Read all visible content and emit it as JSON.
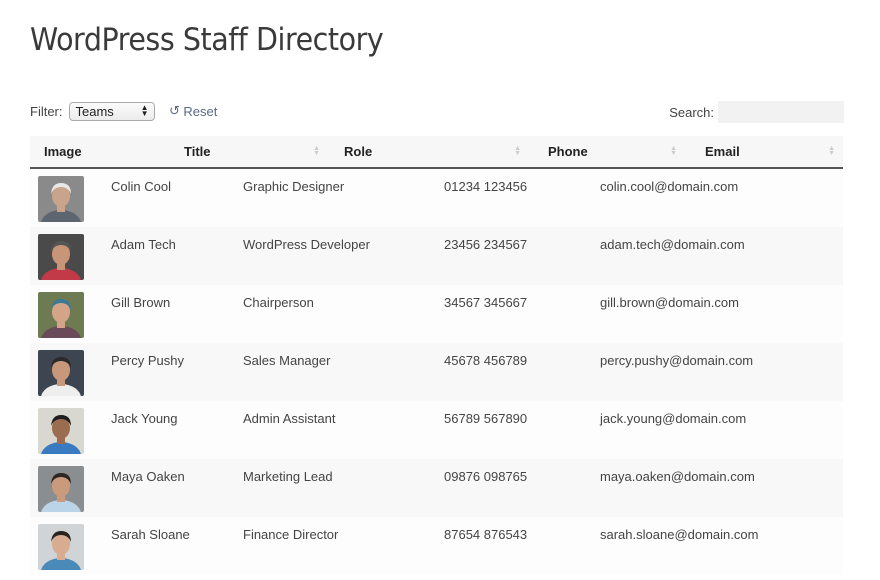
{
  "page": {
    "title": "WordPress Staff Directory"
  },
  "filter": {
    "label": "Filter:",
    "selected": "Teams",
    "reset_label": "Reset",
    "reset_icon": "undo-icon"
  },
  "search": {
    "label": "Search:",
    "value": "",
    "placeholder": ""
  },
  "table": {
    "headers": [
      "Image",
      "Title",
      "Role",
      "Phone",
      "Email"
    ],
    "rows": [
      {
        "name": "Colin Cool",
        "role": "Graphic Designer",
        "phone": "01234 123456",
        "email": "colin.cool@domain.com",
        "avatar": {
          "bg": "#8a8a8a",
          "skin": "#c9a48a",
          "hair": "#e8e8e8",
          "shirt": "#5d6570"
        }
      },
      {
        "name": "Adam Tech",
        "role": "WordPress Developer",
        "phone": "23456 234567",
        "email": "adam.tech@domain.com",
        "avatar": {
          "bg": "#4a4a4a",
          "skin": "#c99578",
          "hair": "#555555",
          "shirt": "#c23a48"
        }
      },
      {
        "name": "Gill Brown",
        "role": "Chairperson",
        "phone": "34567 345667",
        "email": "gill.brown@domain.com",
        "avatar": {
          "bg": "#6d7a52",
          "skin": "#d4a488",
          "hair": "#3a7a95",
          "shirt": "#6a4a58"
        }
      },
      {
        "name": "Percy Pushy",
        "role": "Sales Manager",
        "phone": "45678 456789",
        "email": "percy.pushy@domain.com",
        "avatar": {
          "bg": "#3d4550",
          "skin": "#c8987a",
          "hair": "#2a2a2a",
          "shirt": "#eeeeee"
        }
      },
      {
        "name": "Jack Young",
        "role": "Admin Assistant",
        "phone": "56789 567890",
        "email": "jack.young@domain.com",
        "avatar": {
          "bg": "#d8d8d0",
          "skin": "#9a6c50",
          "hair": "#1e1e1e",
          "shirt": "#3a7ac0"
        }
      },
      {
        "name": "Maya Oaken",
        "role": "Marketing Lead",
        "phone": "09876 098765",
        "email": "maya.oaken@domain.com",
        "avatar": {
          "bg": "#8a8e90",
          "skin": "#c99a7c",
          "hair": "#2e2622",
          "shirt": "#bcd4e8"
        }
      },
      {
        "name": "Sarah Sloane",
        "role": "Finance Director",
        "phone": "87654 876543",
        "email": "sarah.sloane@domain.com",
        "avatar": {
          "bg": "#d0d4d6",
          "skin": "#d8ac90",
          "hair": "#2a2420",
          "shirt": "#4a8ab8"
        }
      }
    ]
  },
  "colors": {
    "reset_link": "#5c6a86",
    "header_bg": "#f7f7f7",
    "header_border": "#555555",
    "row_alt_bg": "#f8f8f8"
  }
}
